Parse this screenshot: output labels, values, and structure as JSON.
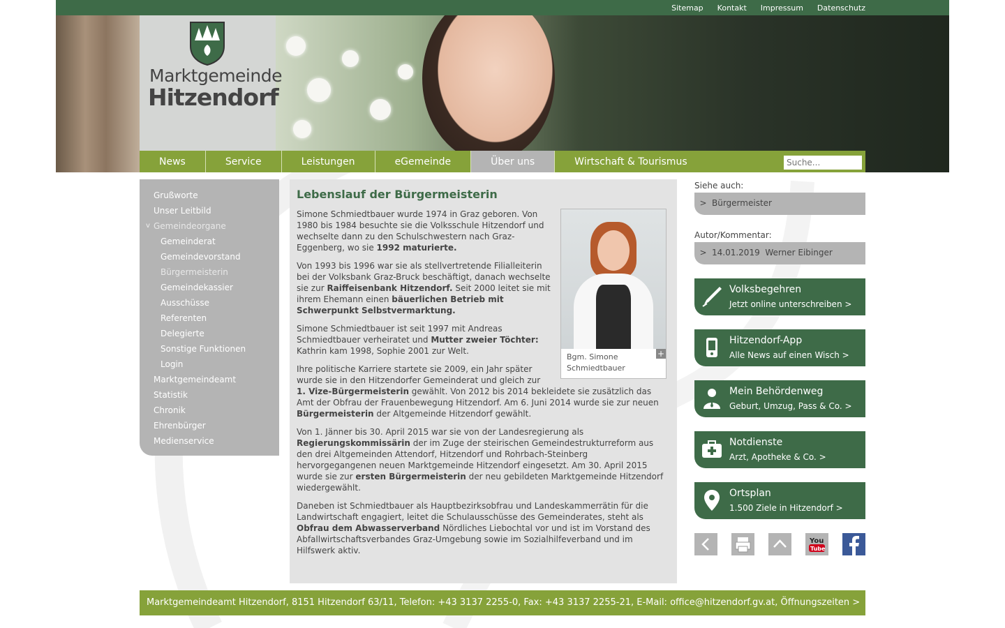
{
  "toplinks": [
    "Sitemap",
    "Kontakt",
    "Impressum",
    "Datenschutz"
  ],
  "logo": {
    "line1": "Marktgemeinde",
    "line2": "Hitzendorf"
  },
  "nav": {
    "items": [
      "News",
      "Service",
      "Leistungen",
      "eGemeinde",
      "Über uns",
      "Wirtschaft & Tourismus"
    ],
    "active": "Über uns",
    "search_placeholder": "Suche..."
  },
  "sidebar": {
    "items": [
      {
        "label": "Grußworte"
      },
      {
        "label": "Unser Leitbild"
      },
      {
        "label": "Gemeindeorgane",
        "expanded_icon": "v"
      },
      {
        "label": "Gemeinderat"
      },
      {
        "label": "Gemeindevorstand"
      },
      {
        "label": "Bürgermeisterin"
      },
      {
        "label": "Gemeindekassier"
      },
      {
        "label": "Ausschüsse"
      },
      {
        "label": "Referenten"
      },
      {
        "label": "Delegierte"
      },
      {
        "label": "Sonstige Funktionen"
      },
      {
        "label": "Login"
      },
      {
        "label": "Marktgemeindeamt"
      },
      {
        "label": "Statistik"
      },
      {
        "label": "Chronik"
      },
      {
        "label": "Ehrenbürger"
      },
      {
        "label": "Medienservice"
      }
    ]
  },
  "article": {
    "title": "Lebenslauf der Bürgermeisterin",
    "caption": "Bgm. Simone Schmiedtbauer",
    "p1a": "Simone Schmiedtbauer wurde 1974 in Graz geboren. Von 1980 bis 1984 besuchte sie die Volksschule Hitzendorf und wechselte dann zu den Schulschwestern nach Graz-Eggenberg, wo sie ",
    "p1b": "1992 maturierte.",
    "p2a": "Von 1993 bis 1996 war sie als stellvertretende Filialleiterin bei der Volksbank Graz-Bruck beschäftigt, danach wechselte sie zur ",
    "p2b": "Raiffeisenbank Hitzendorf.",
    "p2c": " Seit 2000 leitet sie mit ihrem Ehemann einen ",
    "p2d": "bäuerlichen Betrieb mit Schwerpunkt Selbstvermarktung.",
    "p3a": "Simone Schmiedtbauer ist seit 1997 mit Andreas Schmiedtbauer verheiratet und ",
    "p3b": "Mutter zweier Töchter:",
    "p3c": " Kathrin kam 1998, Sophie 2001 zur Welt.",
    "p4a": "Ihre politische Karriere startete sie 2009, ein Jahr später wurde sie in den Hitzendorfer Gemeinderat und gleich zur ",
    "p4b": "1. Vize-Bürgermeisterin",
    "p4c": " gewählt. Von 2012 bis 2014 bekleidete sie zusätzlich das Amt der Obfrau der Frauenbewegung Hitzendorf. Am 6. Juni 2014 wurde sie zur neuen ",
    "p4d": "Bürgermeisterin",
    "p4e": " der Altgemeinde Hitzendorf gewählt.",
    "p5a": "Von 1. Jänner bis 30. April 2015 war sie von der Landesregierung als ",
    "p5b": "Regierungskommissärin",
    "p5c": " der im Zuge der steirischen Gemeindestrukturreform aus den drei Altgemeinden Attendorf, Hitzendorf und Rohrbach-Steinberg hervorgegangenen neuen Marktgemeinde Hitzendorf eingesetzt. Am 30. April 2015 wurde sie zur ",
    "p5d": "ersten Bürgermeisterin",
    "p5e": " der neu gebildeten Marktgemeinde Hitzendorf wiedergewählt.",
    "p6a": "Daneben ist Schmiedtbauer als Hauptbezirksobfrau und Landeskammerrätin für die Landwirtschaft engagiert, leitet die Schulausschüsse des Gemeinderates, steht als ",
    "p6b": "Obfrau dem Abwasserverband",
    "p6c": " Nördliches Liebochtal vor und ist im Vorstand des Abfallwirtschaftsverbandes Graz-Umgebung sowie im Sozialhilfeverband und im Hilfswerk aktiv."
  },
  "right": {
    "see_also_label": "Siehe auch:",
    "see_also_link": "Bürgermeister",
    "author_label": "Autor/Kommentar:",
    "author_date": "14.01.2019",
    "author_name": "Werner Eibinger",
    "tiles": [
      {
        "title": "Volksbegehren",
        "sub": "Jetzt online unterschreiben >",
        "icon": "pen-icon"
      },
      {
        "title": "Hitzendorf-App",
        "sub": "Alle News auf einen Wisch >",
        "icon": "phone-icon"
      },
      {
        "title": "Mein Behördenweg",
        "sub": "Geburt, Umzug, Pass & Co. >",
        "icon": "person-icon"
      },
      {
        "title": "Notdienste",
        "sub": "Arzt, Apotheke & Co. >",
        "icon": "medkit-icon"
      },
      {
        "title": "Ortsplan",
        "sub": "1.500 Ziele in Hitzendorf >",
        "icon": "map-pin-icon"
      }
    ],
    "social": [
      "back-icon",
      "print-icon",
      "top-icon",
      "youtube-icon",
      "facebook-icon"
    ]
  },
  "footer": "Marktgemeindeamt Hitzendorf, 8151 Hitzendorf 63/11, Telefon: +43 3137 2255-0, Fax: +43 3137 2255-21, E-Mail: office@hitzendorf.gv.at, Öffnungszeiten >",
  "colors": {
    "green_dark": "#3e6b48",
    "green_light": "#86a23a",
    "gray": "#b4b4b4",
    "content_bg": "#e2e2e2"
  }
}
